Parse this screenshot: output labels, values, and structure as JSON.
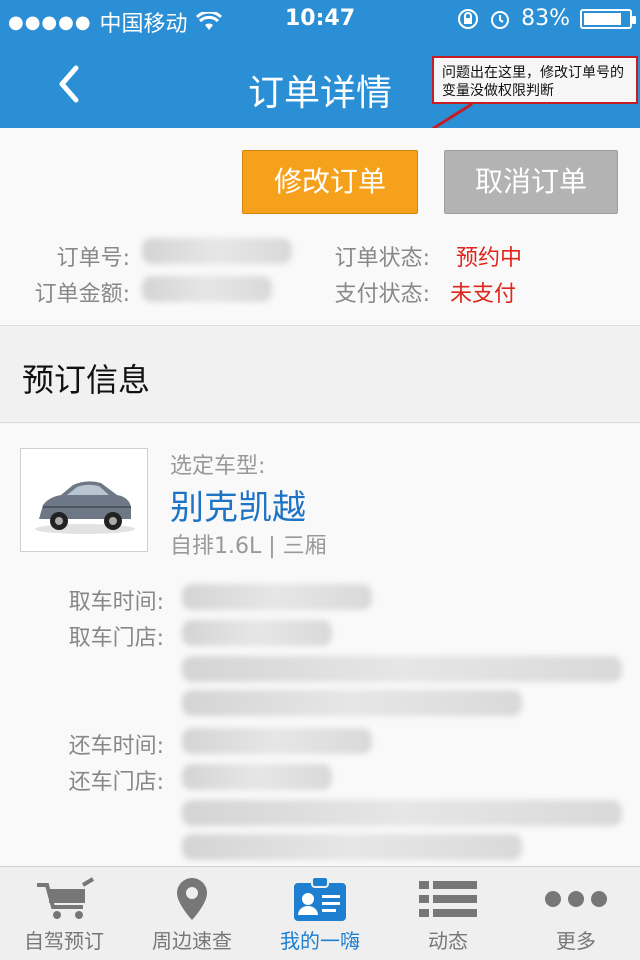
{
  "status_bar": {
    "carrier": "中国移动",
    "time": "10:47",
    "battery_percent": "83%",
    "battery_level": 0.83
  },
  "nav": {
    "title": "订单详情",
    "back_icon": "chevron-left-icon"
  },
  "annotation": {
    "text": "问题出在这里，修改订单号的变量没做权限判断"
  },
  "order": {
    "edit_button": "修改订单",
    "cancel_button": "取消订单",
    "order_no_label": "订单号:",
    "amount_label": "订单金额:",
    "status_label": "订单状态:",
    "status_value": "预约中",
    "pay_status_label": "支付状态:",
    "pay_status_value": "未支付"
  },
  "section": {
    "title": "预订信息"
  },
  "car": {
    "label": "选定车型:",
    "name": "别克凯越",
    "spec": "自排1.6L | 三厢"
  },
  "details": {
    "pickup_time_label": "取车时间:",
    "pickup_store_label": "取车门店:",
    "return_time_label": "还车时间:",
    "return_store_label": "还车门店:"
  },
  "tabbar": {
    "items": [
      {
        "label": "自驾预订",
        "icon": "cart-icon"
      },
      {
        "label": "周边速查",
        "icon": "location-pin-icon"
      },
      {
        "label": "我的一嗨",
        "icon": "id-card-icon",
        "active": true
      },
      {
        "label": "动态",
        "icon": "list-icon"
      },
      {
        "label": "更多",
        "icon": "more-dots-icon"
      }
    ]
  },
  "colors": {
    "header_blue": "#2b8fd6",
    "accent_orange": "#f6a11b",
    "status_red": "#e0251c",
    "car_name_blue": "#1e73c4",
    "tab_active_blue": "#1e7fd0"
  }
}
